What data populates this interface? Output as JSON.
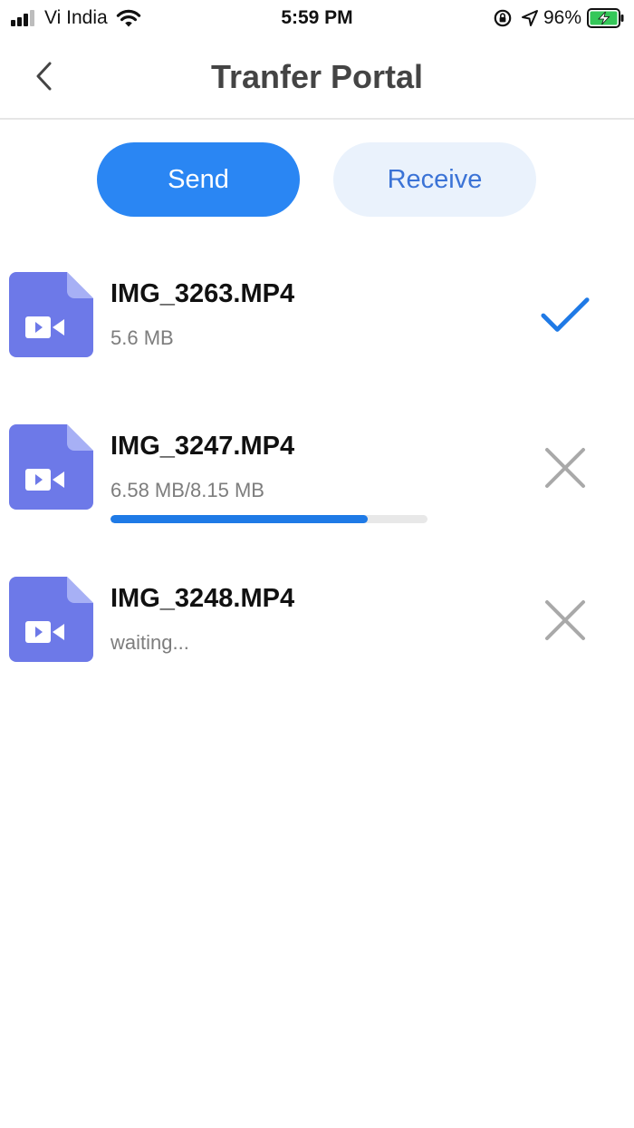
{
  "status_bar": {
    "carrier": "Vi India",
    "time": "5:59 PM",
    "battery_percent": "96%",
    "icons": [
      "signal-bars-icon",
      "wifi-icon",
      "orientation-lock-icon",
      "location-arrow-icon",
      "battery-charging-icon"
    ]
  },
  "nav": {
    "title": "Tranfer Portal",
    "back_icon": "chevron-left-icon"
  },
  "tabs": {
    "send_label": "Send",
    "receive_label": "Receive",
    "active": "send"
  },
  "files": [
    {
      "name": "IMG_3263.MP4",
      "status": "5.6 MB",
      "state": "done",
      "action_icon": "checkmark-icon"
    },
    {
      "name": "IMG_3247.MP4",
      "status": "6.58 MB/8.15 MB",
      "state": "transferring",
      "progress": 0.81,
      "action_icon": "close-icon"
    },
    {
      "name": "IMG_3248.MP4",
      "status": "waiting...",
      "state": "waiting",
      "action_icon": "close-icon"
    }
  ],
  "colors": {
    "accent": "#2a86f3",
    "receive_bg": "#eaf2fc",
    "receive_text": "#3b73d6",
    "file_icon": "#6d79e8",
    "check": "#1f7ae6",
    "close": "#a9a9a9",
    "battery": "#35c759"
  }
}
